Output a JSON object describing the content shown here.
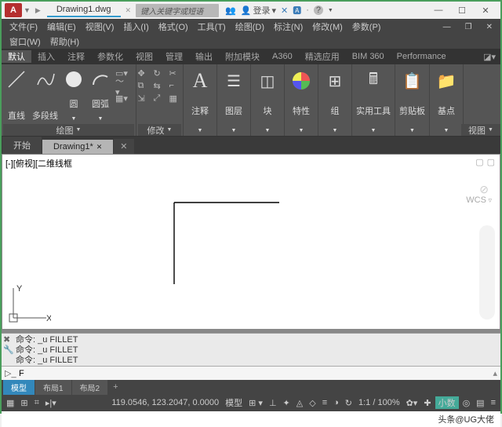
{
  "title": {
    "doc_name": "Drawing1.dwg",
    "search_placeholder": "键入关键字或短语",
    "login_label": "登录"
  },
  "menu": {
    "file": "文件(F)",
    "edit": "编辑(E)",
    "view": "视图(V)",
    "insert": "插入(I)",
    "format": "格式(O)",
    "tools": "工具(T)",
    "draw": "绘图(D)",
    "annotate": "标注(N)",
    "modify": "修改(M)",
    "params": "参数(P)",
    "window": "窗口(W)",
    "help": "帮助(H)"
  },
  "ribbon_tabs": {
    "default": "默认",
    "insert": "插入",
    "annotate": "注释",
    "param": "参数化",
    "view": "视图",
    "manage": "管理",
    "output": "输出",
    "addon": "附加模块",
    "a360": "A360",
    "featured": "精选应用",
    "bim360": "BIM 360",
    "perf": "Performance"
  },
  "ribbon": {
    "draw": {
      "line": "直线",
      "polyline": "多段线",
      "circle": "圆",
      "arc": "圆弧",
      "title": "绘图"
    },
    "modify": {
      "title": "修改"
    },
    "annot": {
      "label": "注释"
    },
    "layer": {
      "label": "图层"
    },
    "block": {
      "label": "块"
    },
    "prop": {
      "label": "特性"
    },
    "group": {
      "label": "组"
    },
    "utility": {
      "label": "实用工具"
    },
    "clipboard": {
      "label": "剪贴板"
    },
    "base": {
      "label": "基点"
    },
    "viewtitle": "视图"
  },
  "edit_tabs": {
    "start": "开始",
    "current": "Drawing1*"
  },
  "canvas": {
    "view_label": "[-][俯视][二维线框",
    "wcs": "WCS",
    "axis_x": "X",
    "axis_y": "Y"
  },
  "cmd": {
    "h1": "命令: _u FILLET",
    "h2": "命令: _u FILLET",
    "h3": "命令: _u FILLET",
    "prompt": "F"
  },
  "layout": {
    "model": "模型",
    "l1": "布局1",
    "l2": "布局2"
  },
  "status": {
    "coords": "119.0546, 123.2047, 0.0000",
    "model": "模型",
    "scale": "1:1 / 100%",
    "decimal": "小数",
    "credit": "头条@UG大佬"
  }
}
